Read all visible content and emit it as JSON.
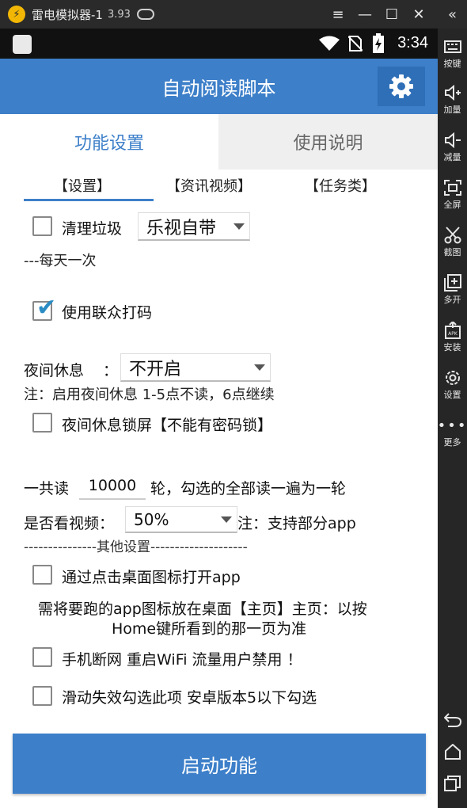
{
  "emulator": {
    "name": "雷电模拟器-1",
    "version": "3.93",
    "sidebar": [
      {
        "label": "按键",
        "icon": "keyboard-icon"
      },
      {
        "label": "加量",
        "icon": "volume-up-icon"
      },
      {
        "label": "减量",
        "icon": "volume-down-icon"
      },
      {
        "label": "全屏",
        "icon": "fullscreen-icon"
      },
      {
        "label": "截图",
        "icon": "scissors-icon"
      },
      {
        "label": "多开",
        "icon": "multi-instance-icon"
      },
      {
        "label": "安装",
        "icon": "apk-install-icon"
      },
      {
        "label": "设置",
        "icon": "settings-icon"
      },
      {
        "label": "更多",
        "icon": "more-icon"
      }
    ]
  },
  "status_bar": {
    "time": "3:34"
  },
  "app": {
    "title": "自动阅读脚本",
    "tabs": [
      {
        "label": "功能设置",
        "active": true
      },
      {
        "label": "使用说明",
        "active": false
      }
    ],
    "subtabs": [
      "【设置】",
      "【资讯视频】",
      "【任务类】"
    ],
    "settings": {
      "clean_label": "清理垃圾",
      "clean_select": "乐视自带",
      "clean_note": "---每天一次",
      "lianzhong_label": "使用联众打码",
      "lianzhong_checked": true,
      "night_label": "夜间休息",
      "night_colon": "：",
      "night_select": "不开启",
      "night_note": "注：启用夜间休息 1-5点不读，6点继续",
      "night_lock_label": "夜间休息锁屏【不能有密码锁】",
      "rounds_prefix": "一共读",
      "rounds_value": "10000",
      "rounds_suffix": "轮，勾选的全部读一遍为一轮",
      "video_label": "是否看视频：",
      "video_select": "50%",
      "video_note": "注：支持部分app",
      "other_divider": "---------------其他设置--------------------",
      "desktop_label": "通过点击桌面图标打开app",
      "desktop_note_line1": "需将要跑的app图标放在桌面【主页】主页：以按",
      "desktop_note_line2": "Home键所看到的那一页为准",
      "wifi_label": "手机断网 重启WiFi 流量用户禁用 ！",
      "swipe_label": "滑动失效勾选此项 安卓版本5以下勾选"
    },
    "start_button": "启动功能"
  },
  "colors": {
    "accent": "#3d7fc9",
    "checkmark": "#2b8cc4"
  }
}
